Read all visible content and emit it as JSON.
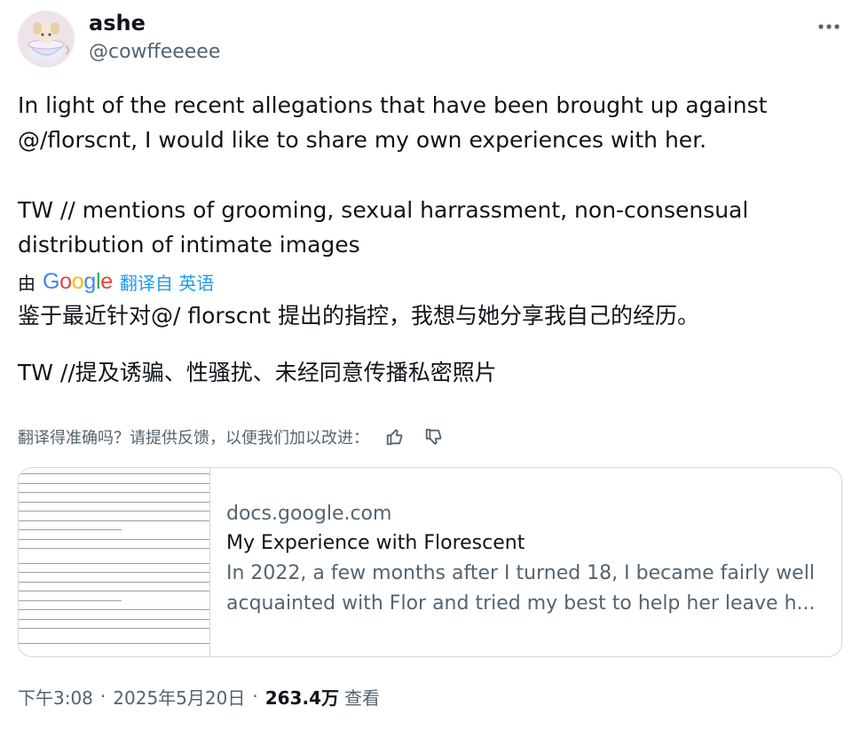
{
  "author": {
    "name": "ashe",
    "handle": "@cowffeeeee"
  },
  "tweet": {
    "original_lines": [
      "In light of the recent allegations that have been brought up against",
      "@/florscnt, I would like to share my own experiences with her.",
      "TW // mentions of grooming, sexual harrassment, non-consensual",
      "distribution of intimate images"
    ],
    "translation_by": "由",
    "google_logo": "Google",
    "translated_from": "翻译自 英语",
    "translated_lines": [
      "鉴于最近针对@/ florscnt 提出的指控，我想与她分享我自己的经历。",
      "TW //提及诱骗、性骚扰、未经同意传播私密照片"
    ],
    "feedback_prompt": "翻译得准确吗？请提供反馈，以便我们加以改进："
  },
  "link_card": {
    "domain": "docs.google.com",
    "title": "My Experience with Florescent",
    "description_lines": [
      "In 2022, a few months after I turned 18, I became fairly well",
      "acquainted with Flor and tried my best to help her leave h..."
    ]
  },
  "meta": {
    "time": "下午3:08",
    "date": "2025年5月20日",
    "separator": "·",
    "views_count": "263.4万",
    "views_label": "查看"
  },
  "icons": {
    "more": "more-icon",
    "thumbs_up": "thumbs-up-icon",
    "thumbs_down": "thumbs-down-icon"
  },
  "colors": {
    "link": "#1d9bf0",
    "secondary_text": "#536471",
    "border": "#cfd9de",
    "google_blue": "#4285f4",
    "google_red": "#ea4335",
    "google_yellow": "#fbbc05",
    "google_green": "#34a853"
  }
}
